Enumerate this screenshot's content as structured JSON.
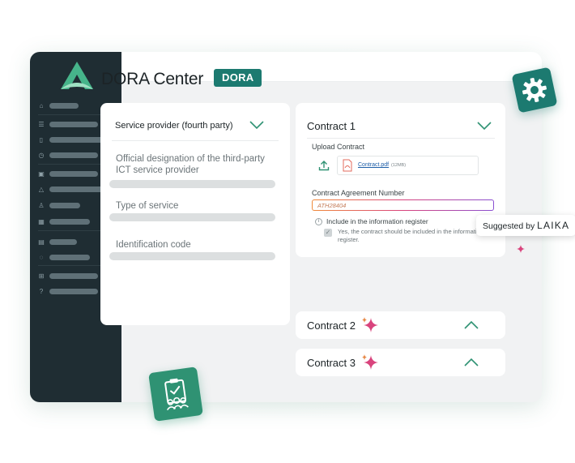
{
  "page": {
    "title": "DORA Center",
    "badge": "DORA"
  },
  "service_provider": {
    "header": "Service provider (fourth party)",
    "fields": [
      {
        "label": "Official designation of the third-party ICT service provider"
      },
      {
        "label": "Type of service"
      },
      {
        "label": "Identification code"
      }
    ]
  },
  "contract1": {
    "title": "Contract 1",
    "upload_label": "Upload Contract",
    "file_name": "Contract.pdf",
    "file_size": "(12MB)",
    "agreement_label": "Contract Agreement Number",
    "agreement_value": "ATH28404",
    "include_label": "Include in the information register",
    "include_text": "Yes, the contract should be included in the information register."
  },
  "contract2": {
    "title": "Contract 2"
  },
  "contract3": {
    "title": "Contract 3"
  },
  "tooltip": {
    "prefix": "Suggested by ",
    "brand": "LAIKA"
  },
  "colors": {
    "brand_teal": "#1c7a70",
    "sidebar": "#1f2d33",
    "accent_green": "#2f9273",
    "sparkle": "#d9447d"
  },
  "icons": [
    "home-icon",
    "list-icon",
    "book-icon",
    "clock-icon",
    "bag-icon",
    "warning-icon",
    "lamp-icon",
    "image-icon",
    "clipboard-icon",
    "cycle-icon",
    "grid-icon",
    "help-icon",
    "gear-icon",
    "sparkle-icon",
    "upload-icon",
    "pdf-icon",
    "chevron-down-icon",
    "chevron-up-icon"
  ]
}
